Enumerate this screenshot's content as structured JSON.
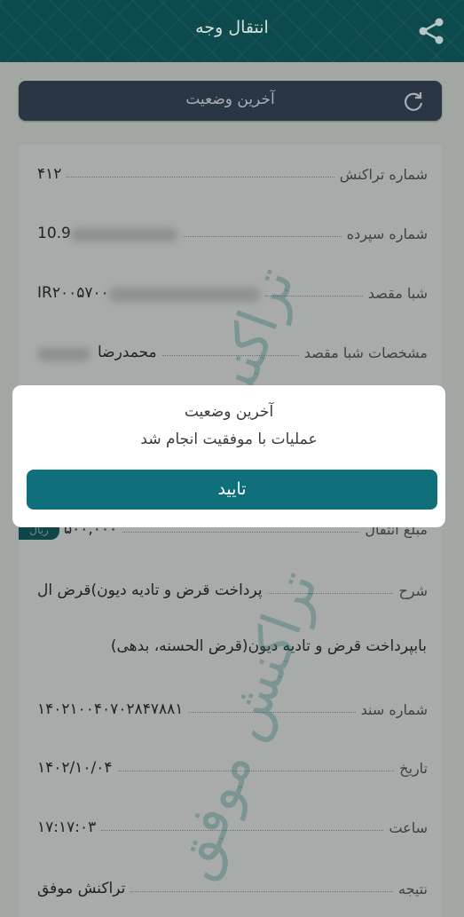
{
  "header": {
    "title": "انتقال وجه",
    "share_icon": "share-icon"
  },
  "status_bar": {
    "label": "آخرین وضعیت",
    "icon": "refresh-icon"
  },
  "details": [
    {
      "label": "شماره تراکنش",
      "value": "۴۱۲"
    },
    {
      "label": "شماره سپرده",
      "value": "10.9"
    },
    {
      "label": "شبا مقصد",
      "value": "IR۲۰۰۵۷۰۰"
    },
    {
      "label": "مشخصات شبا مقصد",
      "value": "محمدرضا"
    },
    {
      "label": "مبلغ انتقال",
      "value": "۵۰۰,۰۰۰"
    },
    {
      "label": "شرح",
      "value": "پرداخت قرض و تادیه دیون)قرض ال"
    },
    {
      "label": "شماره سند",
      "value": "۱۴۰۲۱۰۰۴۰۷۰۲۸۴۷۸۸۱"
    },
    {
      "label": "تاریخ",
      "value": "۱۴۰۲/۱۰/۰۴"
    },
    {
      "label": "ساعت",
      "value": "۱۷:۱۷:۰۳"
    },
    {
      "label": "نتیجه",
      "value": "تراکنش موفق"
    }
  ],
  "description_continued": "بابپرداخت قرض و تادیه دیون(قرض الحسنه، بدهی)",
  "currency_badge": "ریال",
  "watermark": {
    "line1": "تراکنش",
    "line2": "تراکنش موفق"
  },
  "dialog": {
    "title": "آخرین وضعیت",
    "message": "عملیات با موفقیت انجام شد",
    "confirm_label": "تایید"
  },
  "colors": {
    "header_bg": "#0d4a4d",
    "status_bar_bg": "#2b3644",
    "confirm_bg": "#0f6f7a",
    "overlay_bg": "#a3a7a4"
  }
}
